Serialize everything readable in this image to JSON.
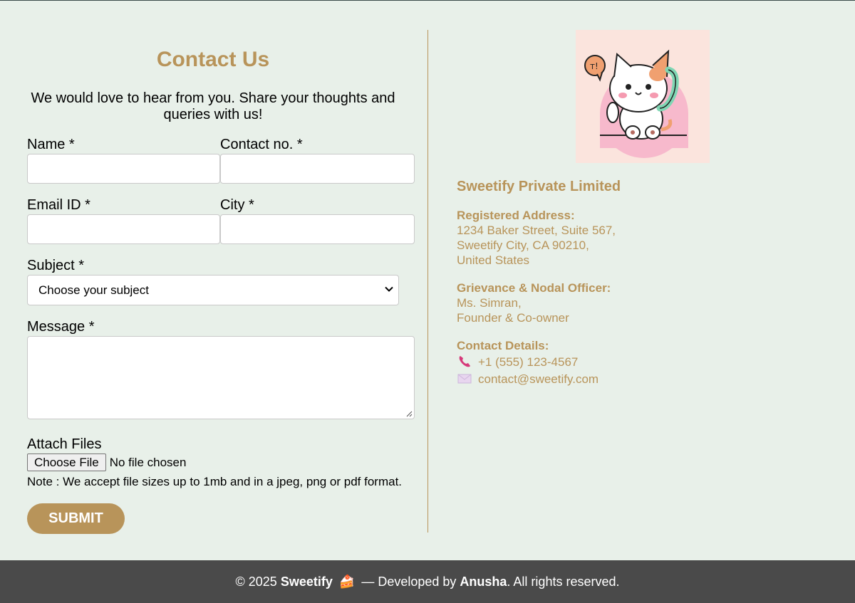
{
  "form": {
    "title": "Contact Us",
    "intro": "We would love to hear from you. Share your thoughts and queries with us!",
    "name_label": "Name *",
    "contact_label": "Contact no. *",
    "email_label": "Email ID *",
    "city_label": "City *",
    "subject_label": "Subject *",
    "subject_selected": "Choose your subject",
    "message_label": "Message *",
    "attach_label": "Attach Files",
    "choose_file_button": "Choose File",
    "file_status": "No file chosen",
    "note": "Note : We accept file sizes up to 1mb and in a jpeg, png or pdf format.",
    "submit_label": "SUBMIT"
  },
  "info": {
    "company": "Sweetify Private Limited",
    "address_heading": "Registered Address:",
    "address_lines": [
      "1234 Baker Street, Suite 567,",
      "Sweetify City, CA 90210,",
      "United States"
    ],
    "officer_heading": "Grievance & Nodal Officer:",
    "officer_lines": [
      "Ms. Simran,",
      "Founder & Co-owner"
    ],
    "contact_heading": "Contact Details:",
    "phone": "+1 (555) 123-4567",
    "email": "contact@sweetify.com",
    "phone_icon": "telephone-icon",
    "email_icon": "envelope-icon",
    "illustration_icon": "cat-on-phone-illustration"
  },
  "footer": {
    "copyright": "© 2025",
    "brand": "Sweetify",
    "cake_icon": "🍰",
    "developed_by": "— Developed by",
    "developer": "Anusha",
    "rights": ". All rights reserved."
  },
  "colors": {
    "accent": "#b8945a",
    "background": "#e8f0e9",
    "footer_bg": "#4a4a4a"
  }
}
